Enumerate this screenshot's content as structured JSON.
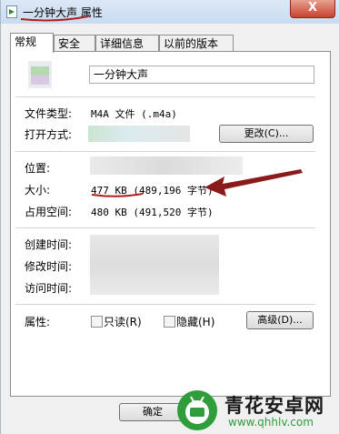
{
  "window": {
    "title_name": "一分钟大声",
    "title_suffix": "属性",
    "close_glyph": "X"
  },
  "tabs": [
    "常规",
    "安全",
    "详细信息",
    "以前的版本"
  ],
  "general": {
    "file_name": "一分钟大声",
    "file_type_label": "文件类型:",
    "file_type_value": "M4A 文件 (.m4a)",
    "open_with_label": "打开方式:",
    "change_button": "更改(C)...",
    "location_label": "位置:",
    "size_label": "大小:",
    "size_value": "477 KB (489,196 字节)",
    "size_on_disk_label": "占用空间:",
    "size_on_disk_value": "480 KB (491,520 字节)",
    "created_label": "创建时间:",
    "modified_label": "修改时间:",
    "accessed_label": "访问时间:",
    "attributes_label": "属性:",
    "readonly_label": "只读(R)",
    "hidden_label": "隐藏(H)",
    "advanced_button": "高级(D)..."
  },
  "footer": {
    "ok_button": "确定"
  },
  "watermark": {
    "brand": "青花安卓网",
    "url": "www.qhhlv.com"
  },
  "colors": {
    "annotation_red": "#b01e1e",
    "watermark_green": "#2e9d3a"
  }
}
